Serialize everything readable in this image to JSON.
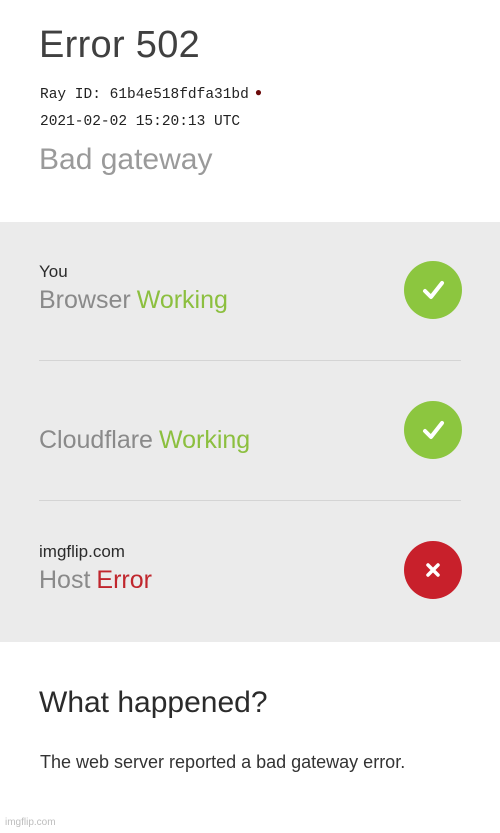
{
  "header": {
    "title": "Error 502",
    "ray_id": "Ray ID: 61b4e518fdfa31bd",
    "timestamp": "2021-02-02 15:20:13 UTC",
    "subtitle": "Bad gateway"
  },
  "status_rows": [
    {
      "location": "You",
      "name": "Browser",
      "state": "Working",
      "icon": "checkmark-icon",
      "color": "#8cc63f"
    },
    {
      "location": "",
      "name": "Cloudflare",
      "state": "Working",
      "icon": "checkmark-icon",
      "color": "#8cc63f"
    },
    {
      "location": "imgflip.com",
      "name": "Host",
      "state": "Error",
      "icon": "close-icon",
      "color": "#c8202b"
    }
  ],
  "what_happened": {
    "heading": "What happened?",
    "text": "The web server reported a bad gateway error."
  },
  "watermark": "imgflip.com"
}
